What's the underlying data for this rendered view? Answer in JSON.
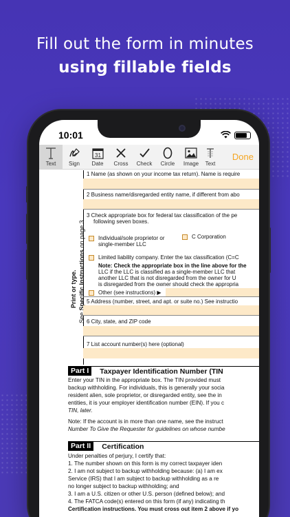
{
  "headline": {
    "line1": "Fill out the form in minutes",
    "line2": "using fillable fields"
  },
  "status": {
    "time": "10:01"
  },
  "toolbar": {
    "tools": [
      {
        "label": "Text",
        "icon": "text-icon",
        "active": true
      },
      {
        "label": "Sign",
        "icon": "sign-icon"
      },
      {
        "label": "Date",
        "icon": "calendar-icon",
        "day": "31"
      },
      {
        "label": "Cross",
        "icon": "cross-icon"
      },
      {
        "label": "Check",
        "icon": "check-icon"
      },
      {
        "label": "Circle",
        "icon": "circle-icon"
      },
      {
        "label": "Image",
        "icon": "image-icon"
      },
      {
        "label": "Text",
        "icon": "text-format-icon"
      }
    ],
    "done": "Done",
    "accent": "#f5a623"
  },
  "form": {
    "side_text_1": "Print or type.",
    "side_text_2": "See",
    "side_text_3": "Specific Instructions",
    "side_text_4": "on page 3.",
    "line1": "1  Name (as shown on your income tax return). Name is require",
    "line2": "2  Business name/disregarded entity name, if different from abo",
    "line3a": "3  Check appropriate box for federal tax classification of the pe",
    "line3b": "following seven boxes.",
    "cb_individual_a": "Individual/sole proprietor or",
    "cb_individual_b": "single-member LLC",
    "cb_ccorp": "C Corporation",
    "cb_llc": "Limited liability company. Enter the tax classification (C=C",
    "note1": "Note: Check the appropriate box in the line above for the",
    "note2": "LLC if the LLC is classified as a single-member LLC that",
    "note3": "another LLC that is not disregarded from the owner for U",
    "note4": "is disregarded from the owner should check the appropria",
    "cb_other": "Other (see instructions) ▶",
    "line5": "5  Address (number, street, and apt. or suite no.) See instructio",
    "line6": "6  City, state, and ZIP code",
    "line7": "7  List account number(s) here (optional)",
    "part1_tag": "Part I",
    "part1_title": "Taxpayer Identification Number (TIN",
    "p1": [
      "Enter your TIN in the appropriate box. The TIN provided must",
      "backup withholding. For individuals, this is generally your socia",
      "resident alien, sole proprietor, or disregarded entity, see the in",
      "entities, it is your employer identification number (EIN). If you c",
      "TIN, later."
    ],
    "p2": [
      "Note: If the account is in more than one name, see the instruct",
      "Number To Give the Requester for guidelines on whose numbe"
    ],
    "part2_tag": "Part II",
    "part2_title": "Certification",
    "p3": [
      "Under penalties of perjury, I certify that:",
      "1. The number shown on this form is my correct taxpayer iden",
      "2. I am not subject to backup withholding because: (a) I am ex",
      "    Service (IRS) that I am subject to backup withholding as a re",
      "    no longer subject to backup withholding; and",
      "3. I am a U.S. citizen or other U.S. person (defined below); and",
      "4. The FATCA code(s) entered on this form (if any) indicating th",
      "Certification instructions. You must cross out item 2 above if yo"
    ]
  }
}
